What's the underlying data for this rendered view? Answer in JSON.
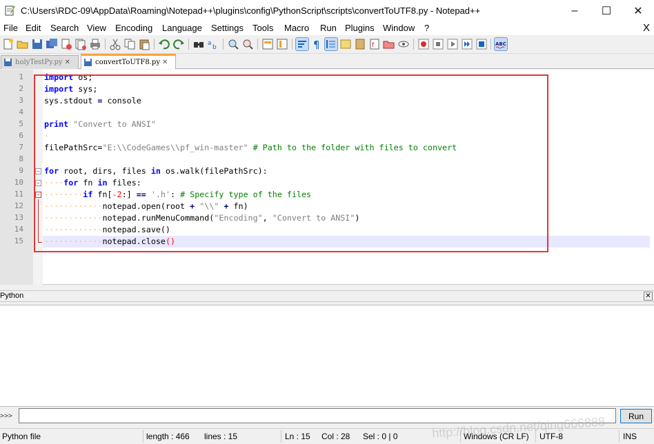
{
  "window": {
    "title": "C:\\Users\\RDC-09\\AppData\\Roaming\\Notepad++\\plugins\\config\\PythonScript\\scripts\\convertToUTF8.py - Notepad++",
    "minimize": "–",
    "maximize": "☐",
    "close": "✕"
  },
  "menu": {
    "items": [
      "File",
      "Edit",
      "Search",
      "View",
      "Encoding",
      "Language",
      "Settings",
      "Tools",
      "Macro",
      "Run",
      "Plugins",
      "Window",
      "?"
    ],
    "close": "X"
  },
  "tabs": [
    {
      "label": "holyTestPy.py",
      "active": false,
      "close": "✕"
    },
    {
      "label": "convertToUTF8.py",
      "active": true,
      "close": "✕"
    }
  ],
  "editor": {
    "line_numbers": [
      "1",
      "2",
      "3",
      "4",
      "5",
      "6",
      "7",
      "8",
      "9",
      "10",
      "11",
      "12",
      "13",
      "14",
      "15"
    ],
    "current_line": 15,
    "fold_markers": [
      "−",
      "−",
      "−"
    ],
    "lines": {
      "l1_kw": "import",
      "l1_rest": " os;",
      "l2_kw": "import",
      "l2_rest": " sys;",
      "l3_a": "sys.stdout",
      "l3_op": "=",
      "l3_b": "console",
      "l5_kw": "print",
      "l5_str": "\"Convert to ANSI\"",
      "l6_dot": "·",
      "l7_a": "filePathSrc=",
      "l7_str": "\"E:\\\\CodeGames\\\\pf_win-master\"",
      "l7_cmt": "# Path to the folder with files to convert",
      "l9_kw1": "for",
      "l9_a": " root, dirs, files ",
      "l9_kw2": "in",
      "l9_b": " os.walk(filePathSrc):",
      "l10_kw1": "for",
      "l10_a": " fn ",
      "l10_kw2": "in",
      "l10_b": " files:",
      "l11_kw": "if",
      "l11_a": " fn[",
      "l11_num": "-2",
      "l11_b": ":] ",
      "l11_op": "==",
      "l11_str": "'.h'",
      "l11_c": ":",
      "l11_cmt": "# Specify type of the files",
      "l12_a": "notepad.open(root ",
      "l12_op1": "+",
      "l12_str": "\"\\\\\"",
      "l12_op2": "+",
      "l12_b": " fn)",
      "l13_a": "notepad.runMenuCommand(",
      "l13_str1": "\"Encoding\"",
      "l13_b": ", ",
      "l13_str2": "\"Convert to ANSI\"",
      "l13_c": ")",
      "l14_a": "notepad.save()",
      "l15_a": "notepad.close",
      "l15_paren": "()"
    }
  },
  "console": {
    "panel_title": "Python",
    "panel_close": "✕",
    "prompt": ">>>",
    "input_value": "",
    "run_label": "Run"
  },
  "status": {
    "file_type": "Python file",
    "length": "length : 466",
    "lines": "lines : 15",
    "ln": "Ln : 15",
    "col": "Col : 28",
    "sel": "Sel : 0 | 0",
    "eol": "Windows (CR LF)",
    "encoding": "UTF-8",
    "mode": "INS"
  },
  "watermark": "http://blog.csdn.net/qing666888",
  "colors": {
    "keyword": "#0000ff",
    "string": "#808080",
    "comment": "#008000",
    "number": "#ff0000",
    "highlight_box": "#e53333",
    "active_tab_accent": "#f9a43b"
  }
}
